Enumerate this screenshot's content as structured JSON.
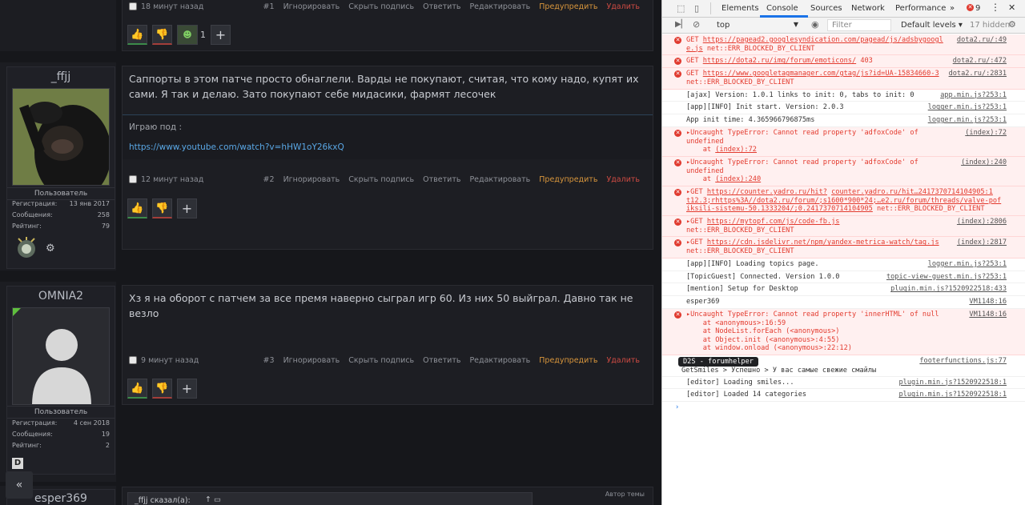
{
  "forum": {
    "posts": [
      {
        "id": "post1",
        "meta": {
          "time": "18 минут назад",
          "num": "#1"
        },
        "reactions": {
          "count": "1"
        }
      },
      {
        "id": "post2",
        "user": {
          "name": "_ffjj",
          "title": "Пользователь",
          "stats": [
            {
              "label": "Регистрация:",
              "value": "13 янв 2017"
            },
            {
              "label": "Сообщения:",
              "value": "258"
            },
            {
              "label": "Рейтинг:",
              "value": "79"
            }
          ]
        },
        "text": "Саппорты в этом патче просто обнаглели. Варды не покупают, считая, что кому надо, купят их сами. Я так и делаю. Зато покупают себе мидасики, фармят лесочек",
        "signature": {
          "label": "Играю под :",
          "link": "https://www.youtube.com/watch?v=hHW1oY26kxQ"
        },
        "meta": {
          "time": "12 минут назад",
          "num": "#2"
        }
      },
      {
        "id": "post3",
        "user": {
          "name": "OMNIA2",
          "title": "Пользователь",
          "stats": [
            {
              "label": "Регистрация:",
              "value": "4 сен 2018"
            },
            {
              "label": "Сообщения:",
              "value": "19"
            },
            {
              "label": "Рейтинг:",
              "value": "2"
            }
          ],
          "badge": "D"
        },
        "text": "Хз я на оборот с патчем за все премя наверно сыграл игр 60. Из них 50 выйграл. Давно так не везло",
        "meta": {
          "time": "9 минут назад",
          "num": "#3"
        }
      },
      {
        "id": "post4",
        "user": {
          "name": "esper369"
        },
        "quote": "_ffjj сказал(а):",
        "author_label": "Автор темы"
      }
    ],
    "actions": {
      "ignore": "Игнорировать",
      "hide_sig": "Скрыть подпись",
      "reply": "Ответить",
      "edit": "Редактировать",
      "warn": "Предупредить",
      "delete": "Удалить"
    },
    "scroll_top_icon": "double-chevron-up-icon"
  },
  "devtools": {
    "tabs": [
      "Elements",
      "Console",
      "Sources",
      "Network",
      "Performance"
    ],
    "active_tab": "Console",
    "more": "»",
    "error_count": "9",
    "context": "top",
    "filter_placeholder": "Filter",
    "levels": "Default levels ▾",
    "hidden": "17 hidden",
    "entries": [
      {
        "type": "err",
        "html_lines": [
          "GET <u>https://pagead2.googlesyndication.com/pagead/js/adsbygoogl</u>",
          "<u>e.js</u> net::ERR_BLOCKED_BY_CLIENT"
        ],
        "src": "dota2.ru/:49"
      },
      {
        "type": "err",
        "html_lines": [
          "GET <u>https://dota2.ru/img/forum/emoticons/</u> 403"
        ],
        "src": "dota2.ru/:472"
      },
      {
        "type": "err",
        "html_lines": [
          "GET <u>https://www.googletagmanager.com/gtag/js?id=UA-15834660-3</u>",
          "net::ERR_BLOCKED_BY_CLIENT"
        ],
        "src": "dota2.ru/:2831"
      },
      {
        "type": "log",
        "html_lines": [
          "[ajax] Version: 1.0.1 links to init: 0, tabs to init: 0"
        ],
        "src": "app.min.js?253:1"
      },
      {
        "type": "log",
        "html_lines": [
          "[app][INFO] Init start. Version: 2.0.3"
        ],
        "src": "logger.min.js?253:1"
      },
      {
        "type": "log",
        "html_lines": [
          "App init time: 4.365966796875ms"
        ],
        "src": "logger.min.js?253:1"
      },
      {
        "type": "err",
        "html_lines": [
          "▸Uncaught TypeError: Cannot read property 'adfoxCode' of",
          "undefined",
          "&nbsp;&nbsp;&nbsp;&nbsp;at <u>(index):72</u>"
        ],
        "src": "(index):72"
      },
      {
        "type": "err",
        "html_lines": [
          "▸Uncaught TypeError: Cannot read property 'adfoxCode' of",
          "undefined",
          "&nbsp;&nbsp;&nbsp;&nbsp;at <u>(index):240</u>"
        ],
        "src": "(index):240"
      },
      {
        "type": "err",
        "html_lines": [
          "▸GET <u>https://counter.yadro.ru/hit?</u> <u>counter.yadro.ru/hit…2417370714104905:1</u>",
          "<u>t12.3;rhttps%3A//dota2.ru/forum/;s1600*900*24;…e2.ru/forum/threads/valve-pof</u>",
          "<u>iksili-sistemu-50.1333204/;0.2417370714104905</u> net::ERR_BLOCKED_BY_CLIENT"
        ],
        "src": ""
      },
      {
        "type": "err",
        "html_lines": [
          "▸GET <u>https://mytopf.com/js/code-fb.js</u>",
          "net::ERR_BLOCKED_BY_CLIENT"
        ],
        "src": "(index):2806"
      },
      {
        "type": "err",
        "html_lines": [
          "▸GET <u>https://cdn.jsdelivr.net/npm/yandex-metrica-watch/tag.js</u>",
          "net::ERR_BLOCKED_BY_CLIENT"
        ],
        "src": "(index):2817"
      },
      {
        "type": "log",
        "html_lines": [
          "[app][INFO] Loading topics page."
        ],
        "src": "logger.min.js?253:1"
      },
      {
        "type": "log",
        "html_lines": [
          "[TopicGuest] Connected. Version 1.0.0"
        ],
        "src": "topic-view-guest.min.js?253:1"
      },
      {
        "type": "log",
        "html_lines": [
          "[mention] Setup for Desktop"
        ],
        "src": "plugin.min.js?1520922518:433"
      },
      {
        "type": "log",
        "html_lines": [
          "esper369"
        ],
        "src": "VM1148:16"
      },
      {
        "type": "err",
        "html_lines": [
          "▸Uncaught TypeError: Cannot read property 'innerHTML' of null",
          "&nbsp;&nbsp;&nbsp;&nbsp;at &lt;anonymous&gt;:16:59",
          "&nbsp;&nbsp;&nbsp;&nbsp;at NodeList.forEach (&lt;anonymous&gt;)",
          "&nbsp;&nbsp;&nbsp;&nbsp;at Object.init (&lt;anonymous&gt;:4:55)",
          "&nbsp;&nbsp;&nbsp;&nbsp;at window.onload (&lt;anonymous&gt;:22:12)"
        ],
        "src": "VM1148:16"
      },
      {
        "type": "badge",
        "badge": "D2S - forumhelper",
        "line2": "GetSmiles > Успешно > У вас самые свежие смайлы",
        "src": "footerfunctions.js:77"
      },
      {
        "type": "log",
        "html_lines": [
          "[editor] Loading smiles..."
        ],
        "src": "plugin.min.js?1520922518:1"
      },
      {
        "type": "log",
        "html_lines": [
          "[editor] Loaded 14 categories"
        ],
        "src": "plugin.min.js?1520922518:1"
      }
    ],
    "prompt": "›"
  }
}
